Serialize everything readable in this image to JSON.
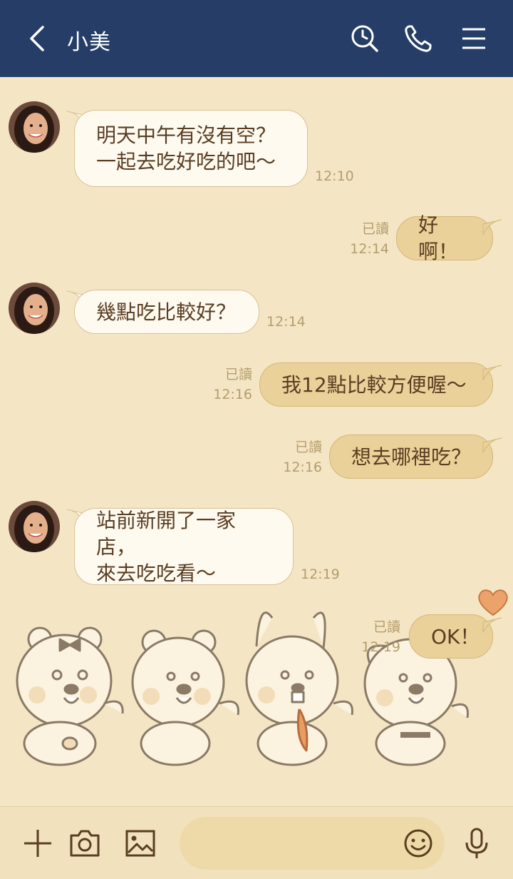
{
  "header": {
    "title": "小美",
    "bg_color": "#263e67"
  },
  "messages": [
    {
      "dir": "in",
      "text": "明天中午有沒有空？\n一起去吃好吃的吧～",
      "time": "12:10"
    },
    {
      "dir": "out",
      "text": "好啊！",
      "read": "已讀",
      "time": "12:14"
    },
    {
      "dir": "in",
      "text": "幾點吃比較好？",
      "time": "12:14"
    },
    {
      "dir": "out",
      "text": "我12點比較方便喔～",
      "read": "已讀",
      "time": "12:16"
    },
    {
      "dir": "out",
      "text": "想去哪裡吃？",
      "read": "已讀",
      "time": "12:16"
    },
    {
      "dir": "in",
      "text": "站前新開了一家店，\n來去吃吃看～",
      "time": "12:19"
    },
    {
      "dir": "out",
      "text": "OK！",
      "read": "已讀",
      "time": "12:19"
    }
  ],
  "icons": {
    "back": "chevron-left-icon",
    "search": "search-history-icon",
    "call": "phone-icon",
    "menu": "menu-icon",
    "add": "plus-icon",
    "camera": "camera-icon",
    "image": "image-icon",
    "emoji": "emoji-icon",
    "mic": "microphone-icon"
  },
  "colors": {
    "background": "#f4e6c4",
    "incoming_bubble": "#fffaf0",
    "outgoing_bubble": "#ead19a",
    "text": "#5a3d22",
    "meta": "#b59c6d"
  }
}
